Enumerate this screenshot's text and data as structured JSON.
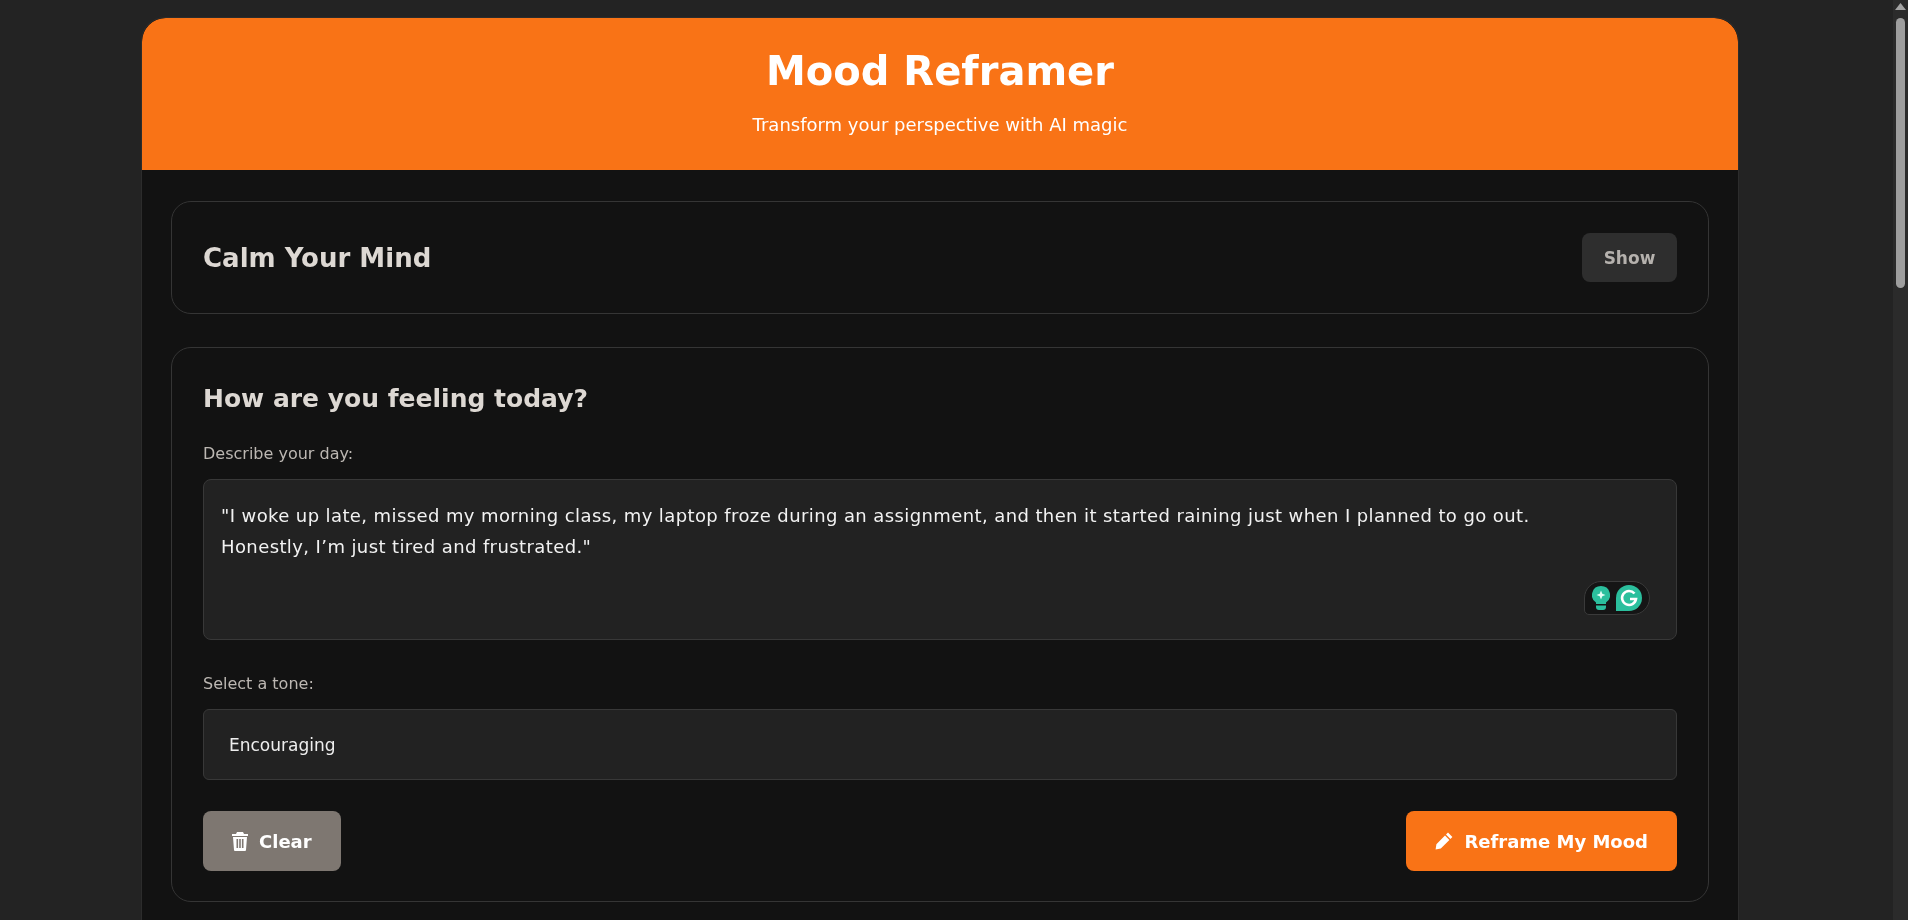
{
  "header": {
    "title": "Mood Reframer",
    "subtitle": "Transform your perspective with AI magic"
  },
  "calm_panel": {
    "title": "Calm Your Mind",
    "toggle_label": "Show"
  },
  "mood_form": {
    "heading": "How are you feeling today?",
    "description": {
      "label": "Describe your day:",
      "value": "\"I woke up late, missed my morning class, my laptop froze during an assignment, and then it started raining just when I planned to go out. Honestly, I’m just tired and frustrated.\""
    },
    "tone": {
      "label": "Select a tone:",
      "value": "Encouraging"
    },
    "actions": [
      {
        "label": "Clear",
        "kind": "secondary"
      },
      {
        "label": "Reframe My Mood",
        "kind": "primary"
      }
    ]
  }
}
